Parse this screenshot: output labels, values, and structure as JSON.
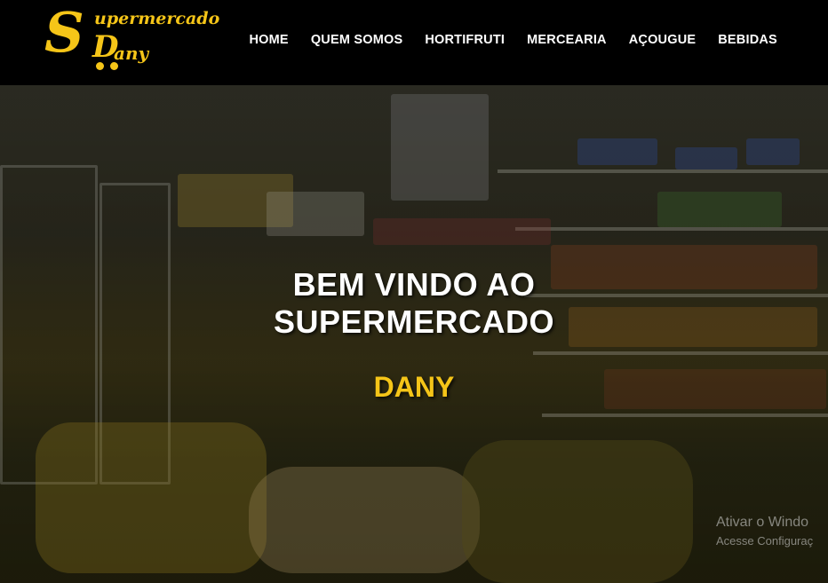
{
  "brand": {
    "logo_initial": "S",
    "logo_top_word": "upermercado",
    "logo_second_initial": "D",
    "logo_bottom_word": "any",
    "color": "#f5c518"
  },
  "nav": {
    "items": [
      {
        "label": "HOME"
      },
      {
        "label": "QUEM SOMOS"
      },
      {
        "label": "HORTIFRUTI"
      },
      {
        "label": "MERCEARIA"
      },
      {
        "label": "AÇOUGUE"
      },
      {
        "label": "BEBIDAS"
      }
    ]
  },
  "hero": {
    "title_line1": "BEM VINDO AO",
    "title_line2": "SUPERMERCADO",
    "subtitle": "DANY"
  },
  "watermark": {
    "title": "Ativar o Windo",
    "subtitle": "Acesse Configuraç"
  }
}
